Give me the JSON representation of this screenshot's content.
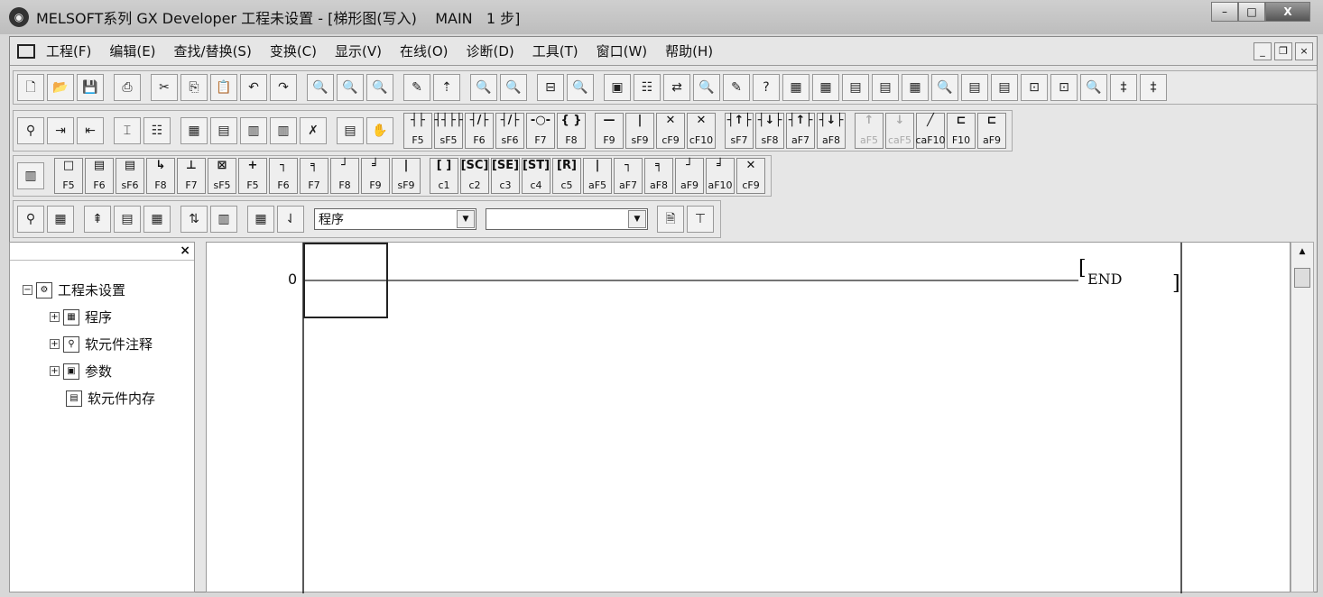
{
  "window": {
    "title": "MELSOFT系列 GX Developer 工程未设置 - [梯形图(写入)    MAIN   1 步]",
    "minimize": "–",
    "maximize": "□",
    "close": "X"
  },
  "menu": [
    "工程(F)",
    "编辑(E)",
    "查找/替换(S)",
    "变换(C)",
    "显示(V)",
    "在线(O)",
    "诊断(D)",
    "工具(T)",
    "窗口(W)",
    "帮助(H)"
  ],
  "mdi": {
    "minimize": "_",
    "restore": "❐",
    "close": "×"
  },
  "toolbar1": [
    "🗋",
    "📂",
    "💾",
    "⎙",
    "✂",
    "⎘",
    "📋",
    "↶",
    "↷",
    "🔍",
    "🔍",
    "🔍",
    "✎",
    "⇡",
    "🔍",
    "🔍",
    "⊟",
    "🔍",
    "▣",
    "☷",
    "⇄",
    "🔍",
    "✎",
    "?",
    "▦",
    "▦",
    "▤",
    "▤",
    "▦",
    "🔍",
    "▤",
    "▤",
    "⊡",
    "⊡",
    "🔍",
    "‡",
    "‡"
  ],
  "toolbar2_left": [
    "⚲",
    "⇥",
    "⇤",
    "⌶",
    "☷",
    "▦",
    "▤",
    "▥",
    "▥",
    "✗",
    "▤",
    "✋"
  ],
  "ladder_buttons": [
    {
      "g": "┤├",
      "k": "F5"
    },
    {
      "g": "┤┤├├",
      "k": "sF5"
    },
    {
      "g": "┤/├",
      "k": "F6"
    },
    {
      "g": "┤/├",
      "k": "sF6"
    },
    {
      "g": "-○-",
      "k": "F7"
    },
    {
      "g": "{ }",
      "k": "F8"
    },
    {
      "g": "—",
      "k": "F9"
    },
    {
      "g": "|",
      "k": "sF9"
    },
    {
      "g": "✕",
      "k": "cF9"
    },
    {
      "g": "✕",
      "k": "cF10"
    },
    {
      "g": "┤↑├",
      "k": "sF7"
    },
    {
      "g": "┤↓├",
      "k": "sF8"
    },
    {
      "g": "┤↑├",
      "k": "aF7"
    },
    {
      "g": "┤↓├",
      "k": "aF8"
    },
    {
      "g": "↑",
      "k": "aF5",
      "dis": true
    },
    {
      "g": "↓",
      "k": "caF5",
      "dis": true
    },
    {
      "g": "╱",
      "k": "caF10"
    },
    {
      "g": "⊏",
      "k": "F10"
    },
    {
      "g": "⊏",
      "k": "aF9"
    }
  ],
  "sfc_buttons": [
    {
      "g": "□",
      "k": "F5"
    },
    {
      "g": "▤",
      "k": "F6"
    },
    {
      "g": "▤",
      "k": "sF6"
    },
    {
      "g": "↳",
      "k": "F8"
    },
    {
      "g": "⊥",
      "k": "F7"
    },
    {
      "g": "⊠",
      "k": "sF5"
    },
    {
      "g": "+",
      "k": "F5"
    },
    {
      "g": "┐",
      "k": "F6"
    },
    {
      "g": "╕",
      "k": "F7"
    },
    {
      "g": "┘",
      "k": "F8"
    },
    {
      "g": "╛",
      "k": "F9"
    },
    {
      "g": "|",
      "k": "sF9"
    },
    {
      "g": "[ ]",
      "k": "c1"
    },
    {
      "g": "[SC]",
      "k": "c2"
    },
    {
      "g": "[SE]",
      "k": "c3"
    },
    {
      "g": "[ST]",
      "k": "c4"
    },
    {
      "g": "[R]",
      "k": "c5"
    },
    {
      "g": "|",
      "k": "aF5"
    },
    {
      "g": "┐",
      "k": "aF7"
    },
    {
      "g": "╕",
      "k": "aF8"
    },
    {
      "g": "┘",
      "k": "aF9"
    },
    {
      "g": "╛",
      "k": "aF10"
    },
    {
      "g": "✕",
      "k": "cF9"
    }
  ],
  "toolbar4_left": [
    "⚲",
    "▦",
    "⇞",
    "▤",
    "▦",
    "⇅",
    "▥",
    "▦",
    "⇃"
  ],
  "program_select": {
    "value": "程序",
    "arrow": "▼"
  },
  "second_select": {
    "value": "",
    "arrow": "▼"
  },
  "toolbar4_right": [
    "🗎",
    "⊤"
  ],
  "tree": {
    "close": "×",
    "root": "工程未设置",
    "items": [
      "程序",
      "软元件注释",
      "参数",
      "软元件内存"
    ]
  },
  "ladder": {
    "step": "0",
    "end": "END"
  },
  "scroll": {
    "up": "▲"
  }
}
